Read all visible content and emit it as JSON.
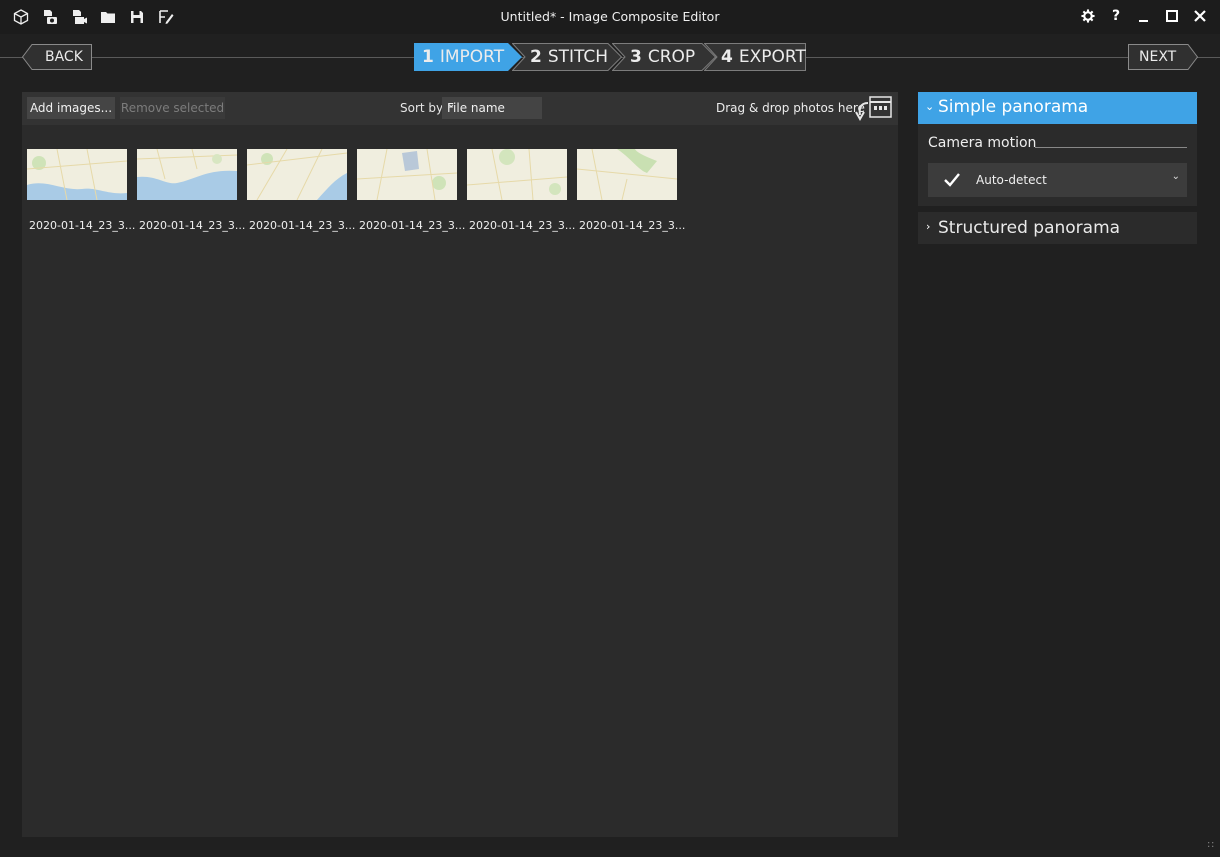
{
  "window": {
    "title": "Untitled* - Image Composite Editor"
  },
  "titlebar_icons": [
    "new-project-icon",
    "new-panorama-from-images-icon",
    "new-panorama-from-video-icon",
    "open-folder-icon",
    "save-icon",
    "rename-icon"
  ],
  "wizard": {
    "back_label": "BACK",
    "next_label": "NEXT",
    "steps": [
      {
        "num": "1",
        "label": "IMPORT",
        "active": true
      },
      {
        "num": "2",
        "label": "STITCH",
        "active": false
      },
      {
        "num": "3",
        "label": "CROP",
        "active": false
      },
      {
        "num": "4",
        "label": "EXPORT",
        "active": false
      }
    ]
  },
  "toolbar": {
    "add_label": "Add images...",
    "remove_label": "Remove selected",
    "sort_label": "Sort by",
    "sort_value": "File name",
    "drag_hint": "Drag & drop photos here"
  },
  "images": [
    {
      "caption": "2020-01-14_23_3..."
    },
    {
      "caption": "2020-01-14_23_3..."
    },
    {
      "caption": "2020-01-14_23_3..."
    },
    {
      "caption": "2020-01-14_23_3..."
    },
    {
      "caption": "2020-01-14_23_3..."
    },
    {
      "caption": "2020-01-14_23_3..."
    }
  ],
  "right_panel": {
    "simple_panorama": "Simple panorama",
    "camera_motion_label": "Camera motion",
    "camera_motion_value": "Auto-detect",
    "structured_panorama": "Structured panorama"
  },
  "colors": {
    "accent": "#3fa3e6",
    "background": "#202020",
    "panel": "#2b2b2b"
  }
}
